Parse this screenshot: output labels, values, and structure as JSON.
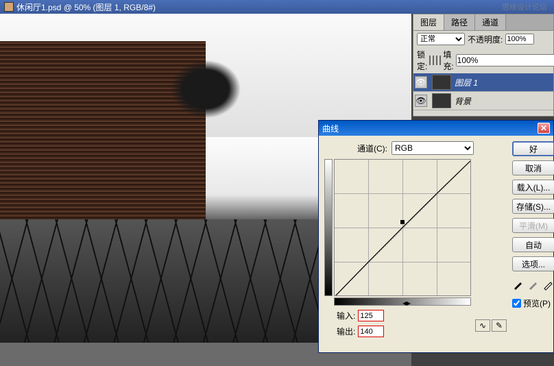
{
  "chart_data": {
    "type": "line",
    "title": "曲线",
    "xlabel": "输入",
    "ylabel": "输出",
    "xlim": [
      0,
      255
    ],
    "ylim": [
      0,
      255
    ],
    "series": [
      {
        "name": "RGB",
        "x": [
          0,
          125,
          255
        ],
        "y": [
          0,
          140,
          255
        ]
      }
    ]
  },
  "watermark": "思缘设计论坛",
  "document": {
    "title": "休闲厅1.psd @ 50% (图层 1, RGB/8#)"
  },
  "layers_panel": {
    "tabs": {
      "layers": "图层",
      "paths": "路径",
      "channels": "通道"
    },
    "blend_mode": "正常",
    "opacity_label": "不透明度:",
    "opacity_value": "100%",
    "lock_label": "锁定:",
    "fill_label": "填充:",
    "fill_value": "100%",
    "layers": [
      {
        "name": "图层 1",
        "visible": true,
        "selected": true
      },
      {
        "name": "背景",
        "visible": true,
        "selected": false
      }
    ]
  },
  "curves": {
    "title": "曲线",
    "channel_label": "通道(C):",
    "channel_value": "RGB",
    "input_label": "输入:",
    "input_value": "125",
    "output_label": "输出:",
    "output_value": "140",
    "buttons": {
      "ok": "好",
      "cancel": "取消",
      "load": "载入(L)...",
      "save": "存储(S)...",
      "smooth": "平滑(M)",
      "auto": "自动",
      "options": "选项..."
    },
    "preview_label": "预览(P)",
    "preview_checked": true
  }
}
